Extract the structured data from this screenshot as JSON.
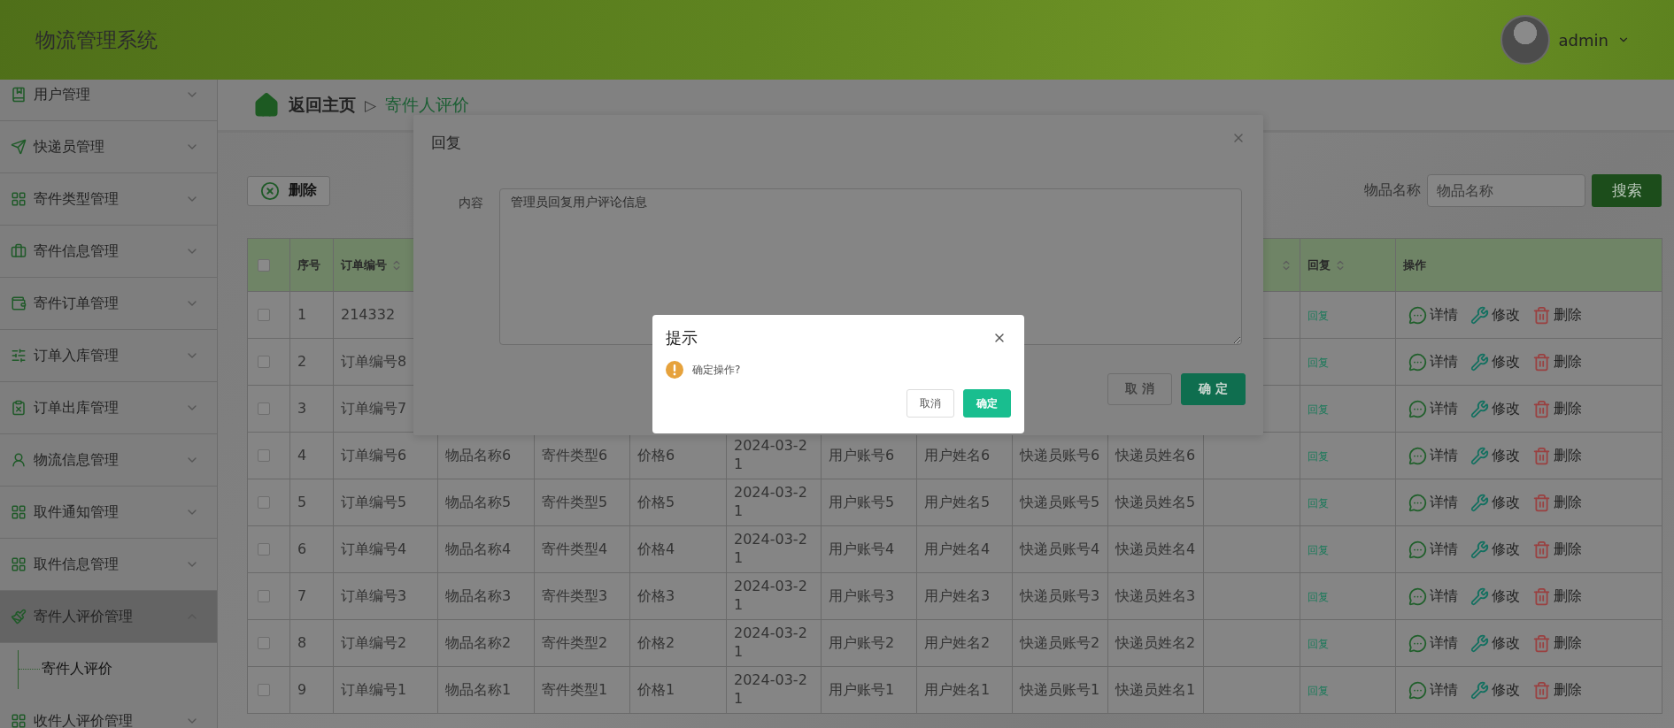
{
  "header": {
    "title": "物流管理系统",
    "user": "admin"
  },
  "sidebar": {
    "items": [
      {
        "label": "用户管理",
        "selected": false,
        "expanded": false
      },
      {
        "label": "快递员管理",
        "selected": false,
        "expanded": false
      },
      {
        "label": "寄件类型管理",
        "selected": false,
        "expanded": false
      },
      {
        "label": "寄件信息管理",
        "selected": false,
        "expanded": false
      },
      {
        "label": "寄件订单管理",
        "selected": false,
        "expanded": false
      },
      {
        "label": "订单入库管理",
        "selected": false,
        "expanded": false
      },
      {
        "label": "订单出库管理",
        "selected": false,
        "expanded": false
      },
      {
        "label": "物流信息管理",
        "selected": false,
        "expanded": false
      },
      {
        "label": "取件通知管理",
        "selected": false,
        "expanded": false
      },
      {
        "label": "取件信息管理",
        "selected": false,
        "expanded": false
      },
      {
        "label": "寄件人评价管理",
        "selected": true,
        "expanded": true,
        "children": [
          {
            "label": "寄件人评价"
          }
        ]
      },
      {
        "label": "收件人评价管理",
        "selected": false,
        "expanded": false
      }
    ]
  },
  "breadcrumb": {
    "home": "返回主页",
    "separator": "▷",
    "current": "寄件人评价"
  },
  "toolbar": {
    "delete_button": "删除",
    "search_label": "物品名称",
    "search_placeholder": "物品名称",
    "search_button": "搜索"
  },
  "table": {
    "header_checked": false,
    "columns": [
      {
        "label": "序号",
        "sortable": false,
        "kind": "text"
      },
      {
        "label": "订单编号",
        "sortable": true,
        "kind": "text"
      },
      {
        "kind": "text"
      },
      {
        "kind": "text"
      },
      {
        "kind": "text"
      },
      {
        "kind": "text"
      },
      {
        "kind": "text"
      },
      {
        "kind": "text"
      },
      {
        "kind": "text"
      },
      {
        "kind": "text"
      },
      {
        "sortable": true,
        "kind": "text"
      },
      {
        "label": "回复",
        "sortable": true,
        "kind": "link"
      },
      {
        "label": "操作",
        "sortable": false,
        "kind": "actions"
      }
    ],
    "rows": [
      {
        "checked": false,
        "cells": [
          "1",
          "214332",
          null,
          null,
          null,
          null,
          null,
          null,
          null,
          null,
          null,
          "回复"
        ],
        "actions": [
          "详情",
          "修改",
          "删除"
        ]
      },
      {
        "checked": false,
        "cells": [
          "2",
          "订单编号8",
          null,
          null,
          null,
          null,
          null,
          null,
          null,
          null,
          null,
          "回复"
        ],
        "actions": [
          "详情",
          "修改",
          "删除"
        ]
      },
      {
        "checked": false,
        "cells": [
          "3",
          "订单编号7",
          null,
          null,
          null,
          null,
          null,
          null,
          null,
          null,
          null,
          "回复"
        ],
        "actions": [
          "详情",
          "修改",
          "删除"
        ]
      },
      {
        "checked": false,
        "cells": [
          "4",
          "订单编号6",
          "物品名称6",
          "寄件类型6",
          "价格6",
          "2024-03-21",
          "用户账号6",
          "用户姓名6",
          "快递员账号6",
          "快递员姓名6",
          null,
          "回复"
        ],
        "actions": [
          "详情",
          "修改",
          "删除"
        ]
      },
      {
        "checked": false,
        "cells": [
          "5",
          "订单编号5",
          "物品名称5",
          "寄件类型5",
          "价格5",
          "2024-03-21",
          "用户账号5",
          "用户姓名5",
          "快递员账号5",
          "快递员姓名5",
          null,
          "回复"
        ],
        "actions": [
          "详情",
          "修改",
          "删除"
        ]
      },
      {
        "checked": false,
        "cells": [
          "6",
          "订单编号4",
          "物品名称4",
          "寄件类型4",
          "价格4",
          "2024-03-21",
          "用户账号4",
          "用户姓名4",
          "快递员账号4",
          "快递员姓名4",
          null,
          "回复"
        ],
        "actions": [
          "详情",
          "修改",
          "删除"
        ]
      },
      {
        "checked": false,
        "cells": [
          "7",
          "订单编号3",
          "物品名称3",
          "寄件类型3",
          "价格3",
          "2024-03-21",
          "用户账号3",
          "用户姓名3",
          "快递员账号3",
          "快递员姓名3",
          null,
          "回复"
        ],
        "actions": [
          "详情",
          "修改",
          "删除"
        ]
      },
      {
        "checked": false,
        "cells": [
          "8",
          "订单编号2",
          "物品名称2",
          "寄件类型2",
          "价格2",
          "2024-03-21",
          "用户账号2",
          "用户姓名2",
          "快递员账号2",
          "快递员姓名2",
          null,
          "回复"
        ],
        "actions": [
          "详情",
          "修改",
          "删除"
        ]
      },
      {
        "checked": false,
        "cells": [
          "9",
          "订单编号1",
          "物品名称1",
          "寄件类型1",
          "价格1",
          "2024-03-21",
          "用户账号1",
          "用户姓名1",
          "快递员账号1",
          "快递员姓名1",
          null,
          "回复"
        ],
        "actions": [
          "详情",
          "修改",
          "删除"
        ]
      }
    ]
  },
  "reply_dialog": {
    "title": "回复",
    "field_label": "内容",
    "field_value": "管理员回复用户评论信息",
    "buttons": [
      "取 消",
      "确 定"
    ]
  },
  "confirm_dialog": {
    "title": "提示",
    "message": "确定操作?",
    "buttons": [
      "取消",
      "确定"
    ]
  }
}
